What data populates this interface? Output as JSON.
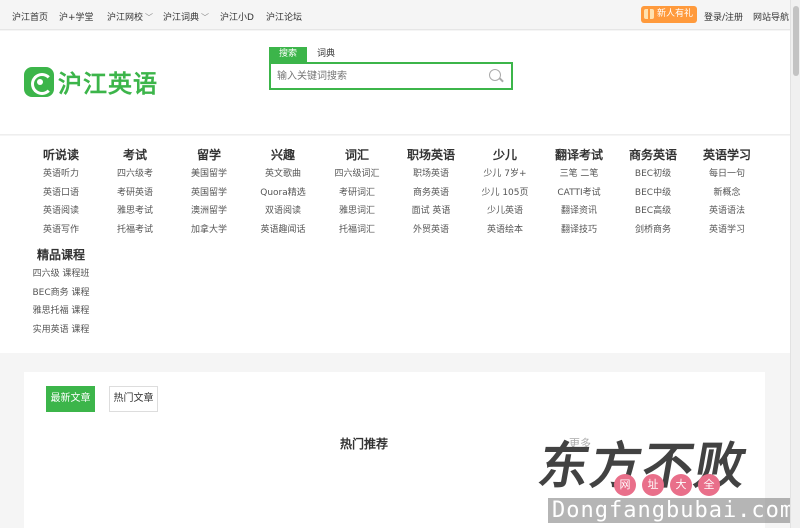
{
  "topnav": {
    "items": [
      "沪江首页",
      "沪+学堂",
      "沪江网校",
      "沪江词典",
      "沪江小D",
      "沪江论坛"
    ],
    "gift_label": "新人有礼",
    "auth_label": "登录/注册",
    "right_menu": "网站导航"
  },
  "header": {
    "logo_text": "沪江英语",
    "search_tabs": [
      "搜索",
      "词典"
    ],
    "search_placeholder": "输入关键词搜索"
  },
  "categories": [
    {
      "title": "听说读",
      "links": [
        "英语听力",
        "英语口语",
        "英语阅读",
        "英语写作"
      ]
    },
    {
      "title": "考试",
      "links": [
        "四六级考",
        "考研英语",
        "雅思考试",
        "托福考试"
      ]
    },
    {
      "title": "留学",
      "links": [
        "美国留学",
        "英国留学",
        "澳洲留学",
        "加拿大学"
      ]
    },
    {
      "title": "兴趣",
      "links": [
        "英文歌曲",
        "Quora精选",
        "双语阅读",
        "英语趣闻话"
      ]
    },
    {
      "title": "词汇",
      "links": [
        "四六级词汇",
        "考研词汇",
        "雅思词汇",
        "托福词汇"
      ]
    },
    {
      "title": "职场英语",
      "links": [
        "职场英语",
        "商务英语",
        "面试 英语",
        "外贸英语"
      ]
    },
    {
      "title": "少儿",
      "links": [
        "少儿 7岁+",
        "少儿 105页",
        "少儿英语",
        "英语绘本"
      ]
    },
    {
      "title": "翻译考试",
      "links": [
        "三笔 二笔",
        "CATTI考试",
        "翻译资讯",
        "翻译技巧"
      ]
    },
    {
      "title": "商务英语",
      "links": [
        "BEC初级",
        "BEC中级",
        "BEC高级",
        "剑桥商务"
      ]
    },
    {
      "title": "英语学习",
      "links": [
        "每日一句",
        "新概念",
        "英语语法",
        "英语学习"
      ]
    },
    {
      "title": "精品课程",
      "links": [
        "四六级 课程班",
        "BEC商务 课程",
        "雅思托福 课程",
        "实用英语 课程"
      ]
    }
  ],
  "card": {
    "primary_button": "最新文章",
    "secondary_button": "热门文章",
    "heading": "热门推荐",
    "side_label": "更多"
  },
  "watermark": {
    "big_text": "东方不败",
    "badges": [
      "网",
      "址",
      "大",
      "全"
    ],
    "url": "Dongfangbubai.com"
  }
}
